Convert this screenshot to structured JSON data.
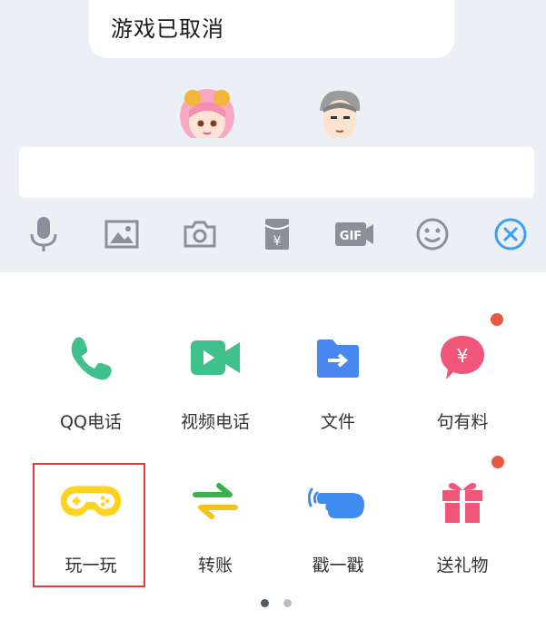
{
  "chat": {
    "last_message": "游戏已取消",
    "input_value": ""
  },
  "toolbar": {
    "items": [
      {
        "icon": "microphone-icon"
      },
      {
        "icon": "image-icon"
      },
      {
        "icon": "camera-icon"
      },
      {
        "icon": "red-packet-icon"
      },
      {
        "icon": "gif-icon",
        "text": "GIF"
      },
      {
        "icon": "emoji-icon"
      },
      {
        "icon": "close-circle-icon"
      }
    ]
  },
  "panel": {
    "items": [
      {
        "label": "QQ电话",
        "icon": "phone-icon",
        "badge": false
      },
      {
        "label": "视频电话",
        "icon": "video-call-icon",
        "badge": false
      },
      {
        "label": "文件",
        "icon": "file-icon",
        "badge": false
      },
      {
        "label": "句有料",
        "icon": "yen-chat-icon",
        "badge": true,
        "icon_text": "¥"
      },
      {
        "label": "玩一玩",
        "icon": "game-controller-icon",
        "badge": false,
        "highlighted": true
      },
      {
        "label": "转账",
        "icon": "transfer-icon",
        "badge": false
      },
      {
        "label": "戳一戳",
        "icon": "poke-hand-icon",
        "badge": false
      },
      {
        "label": "送礼物",
        "icon": "gift-icon",
        "badge": true
      }
    ],
    "pages": 2,
    "current_page": 1
  },
  "colors": {
    "chat_bg": "#eceff3",
    "phone": "#3fc18c",
    "video": "#3fc18c",
    "file": "#4a86f0",
    "yen": "#f0567a",
    "game": "#ffd21e",
    "transfer_top": "#37b24d",
    "transfer_bottom": "#f4c31b",
    "poke": "#3f8cf0",
    "gift": "#f0567a",
    "close": "#3ca0f5",
    "badge": "#e8573f",
    "highlight_border": "#e03a3a"
  }
}
